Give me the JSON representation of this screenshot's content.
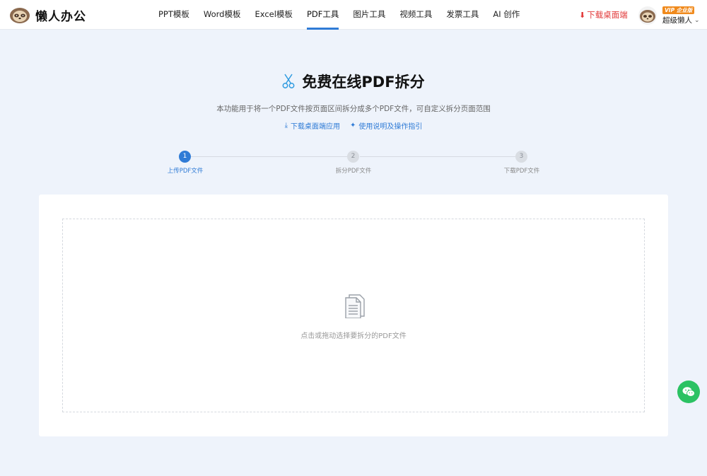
{
  "header": {
    "logo_text": "懒人办公",
    "nav": [
      {
        "label": "PPT模板",
        "active": false
      },
      {
        "label": "Word模板",
        "active": false
      },
      {
        "label": "Excel模板",
        "active": false
      },
      {
        "label": "PDF工具",
        "active": true
      },
      {
        "label": "图片工具",
        "active": false
      },
      {
        "label": "视频工具",
        "active": false
      },
      {
        "label": "发票工具",
        "active": false
      },
      {
        "label": "AI 创作",
        "active": false
      }
    ],
    "download_label": "下载桌面端",
    "vip_badge": "VIP 企业版",
    "username": "超级懒人"
  },
  "main": {
    "title": "免费在线PDF拆分",
    "subtitle": "本功能用于将一个PDF文件按页面区间拆分成多个PDF文件，可自定义拆分页面范围",
    "link_download": "下载桌面端应用",
    "link_guide": "使用说明及操作指引"
  },
  "steps": [
    {
      "number": "1",
      "label": "上传PDF文件",
      "active": true
    },
    {
      "number": "2",
      "label": "拆分PDF文件",
      "active": false
    },
    {
      "number": "3",
      "label": "下载PDF文件",
      "active": false
    }
  ],
  "upload": {
    "prompt": "点击或拖动选择要拆分的PDF文件"
  },
  "colors": {
    "accent": "#2f7bd6",
    "download_red": "#e23b3b",
    "wechat_green": "#2bc263",
    "page_bg": "#eef3fb"
  }
}
